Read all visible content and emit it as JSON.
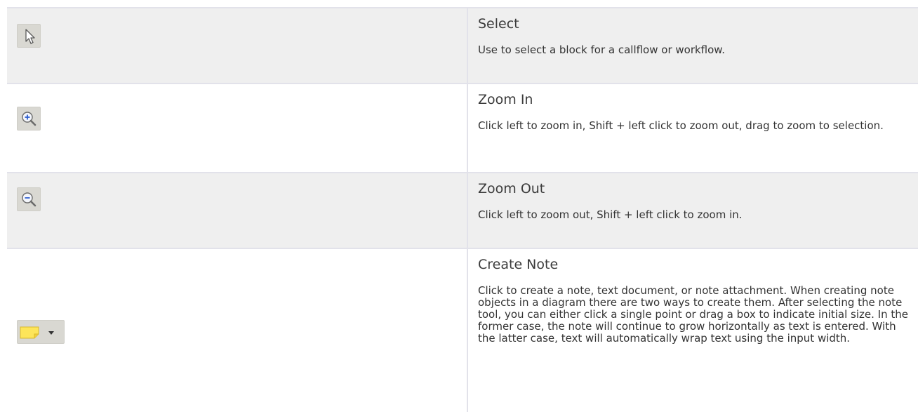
{
  "tools": [
    {
      "icon": "arrow-pointer-icon",
      "title": "Select",
      "description": "Use to select a block for a callflow or workflow."
    },
    {
      "icon": "zoom-in-icon",
      "title": "Zoom In",
      "description": "Click left to zoom in, Shift + left click to zoom out, drag to zoom to selection."
    },
    {
      "icon": "zoom-out-icon",
      "title": "Zoom Out",
      "description": "Click left to zoom out, Shift + left click to zoom in."
    },
    {
      "icon": "note-icon",
      "title": "Create Note",
      "description": "Click to create a note, text document, or note attachment. When creating note objects in a diagram there are two ways to create them. After selecting the note tool, you can either click a single point or drag a box to indicate initial size. In the former case, the note will continue to grow horizontally as text is entered. With the latter case, text will automatically wrap text using the input width."
    }
  ],
  "colors": {
    "row_shaded": "#efefef",
    "border": "#e2e2ea",
    "note_yellow": "#fde55a",
    "zoom_blue": "#2f5fd0"
  }
}
